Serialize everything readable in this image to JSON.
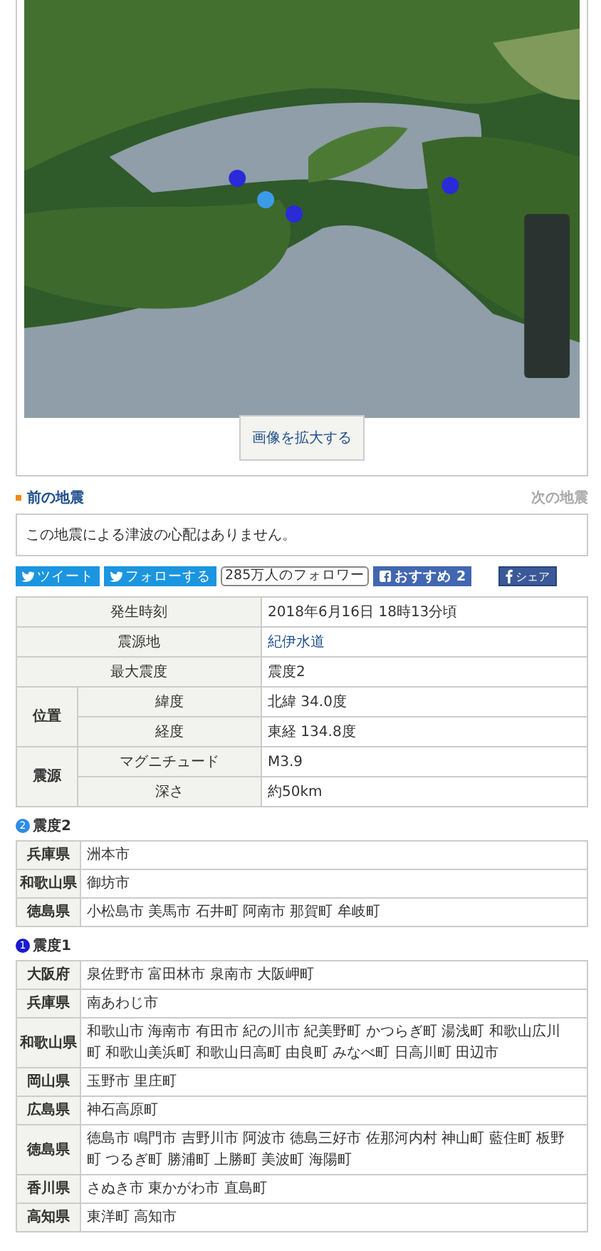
{
  "map_button": "画像を拡大する",
  "nav": {
    "prev": "前の地震",
    "next": "次の地震"
  },
  "tsunami_message": "この地震による津波の心配はありません。",
  "social": [
    {
      "kind": "twitter",
      "label": "ツイート"
    },
    {
      "kind": "twitter",
      "label": "フォローする"
    },
    {
      "kind": "count",
      "label": "285万人のフォロワー"
    },
    {
      "kind": "facebook",
      "label": "おすすめ 2"
    },
    {
      "kind": "share",
      "label": "シェア"
    }
  ],
  "info_table": [
    {
      "kind": "single",
      "label": "発生時刻",
      "value": "2018年6月16日 18時13分頃",
      "link": false
    },
    {
      "kind": "single",
      "label": "震源地",
      "value": "紀伊水道",
      "link": true
    },
    {
      "kind": "single",
      "label": "最大震度",
      "value": "震度2",
      "link": false
    },
    {
      "kind": "group",
      "label": "位置",
      "rows": [
        {
          "label": "緯度",
          "value": "北緯 34.0度"
        },
        {
          "label": "経度",
          "value": "東経 134.8度"
        }
      ]
    },
    {
      "kind": "group",
      "label": "震源",
      "rows": [
        {
          "label": "マグニチュード",
          "value": "M3.9"
        },
        {
          "label": "深さ",
          "value": "約50km"
        }
      ]
    }
  ],
  "intensity_sections": [
    {
      "badge": "2",
      "title": "震度2",
      "color": "#2f8be6",
      "rows": [
        {
          "pref": "兵庫県",
          "cities": "洲本市"
        },
        {
          "pref": "和歌山県",
          "cities": "御坊市"
        },
        {
          "pref": "徳島県",
          "cities": "小松島市 美馬市 石井町 阿南市 那賀町 牟岐町"
        }
      ]
    },
    {
      "badge": "1",
      "title": "震度1",
      "color": "#1a1ad0",
      "rows": [
        {
          "pref": "大阪府",
          "cities": "泉佐野市 富田林市 泉南市 大阪岬町"
        },
        {
          "pref": "兵庫県",
          "cities": "南あわじ市"
        },
        {
          "pref": "和歌山県",
          "cities": "和歌山市 海南市 有田市 紀の川市 紀美野町 かつらぎ町 湯浅町 和歌山広川町 和歌山美浜町 和歌山日高町 由良町 みなべ町 日高川町 田辺市"
        },
        {
          "pref": "岡山県",
          "cities": "玉野市 里庄町"
        },
        {
          "pref": "広島県",
          "cities": "神石高原町"
        },
        {
          "pref": "徳島県",
          "cities": "徳島市 鳴門市 吉野川市 阿波市 徳島三好市 佐那河内村 神山町 藍住町 板野町 つるぎ町 勝浦町 上勝町 美波町 海陽町"
        },
        {
          "pref": "香川県",
          "cities": "さぬき市 東かがわ市 直島町"
        },
        {
          "pref": "高知県",
          "cities": "東洋町 高知市"
        }
      ]
    }
  ]
}
